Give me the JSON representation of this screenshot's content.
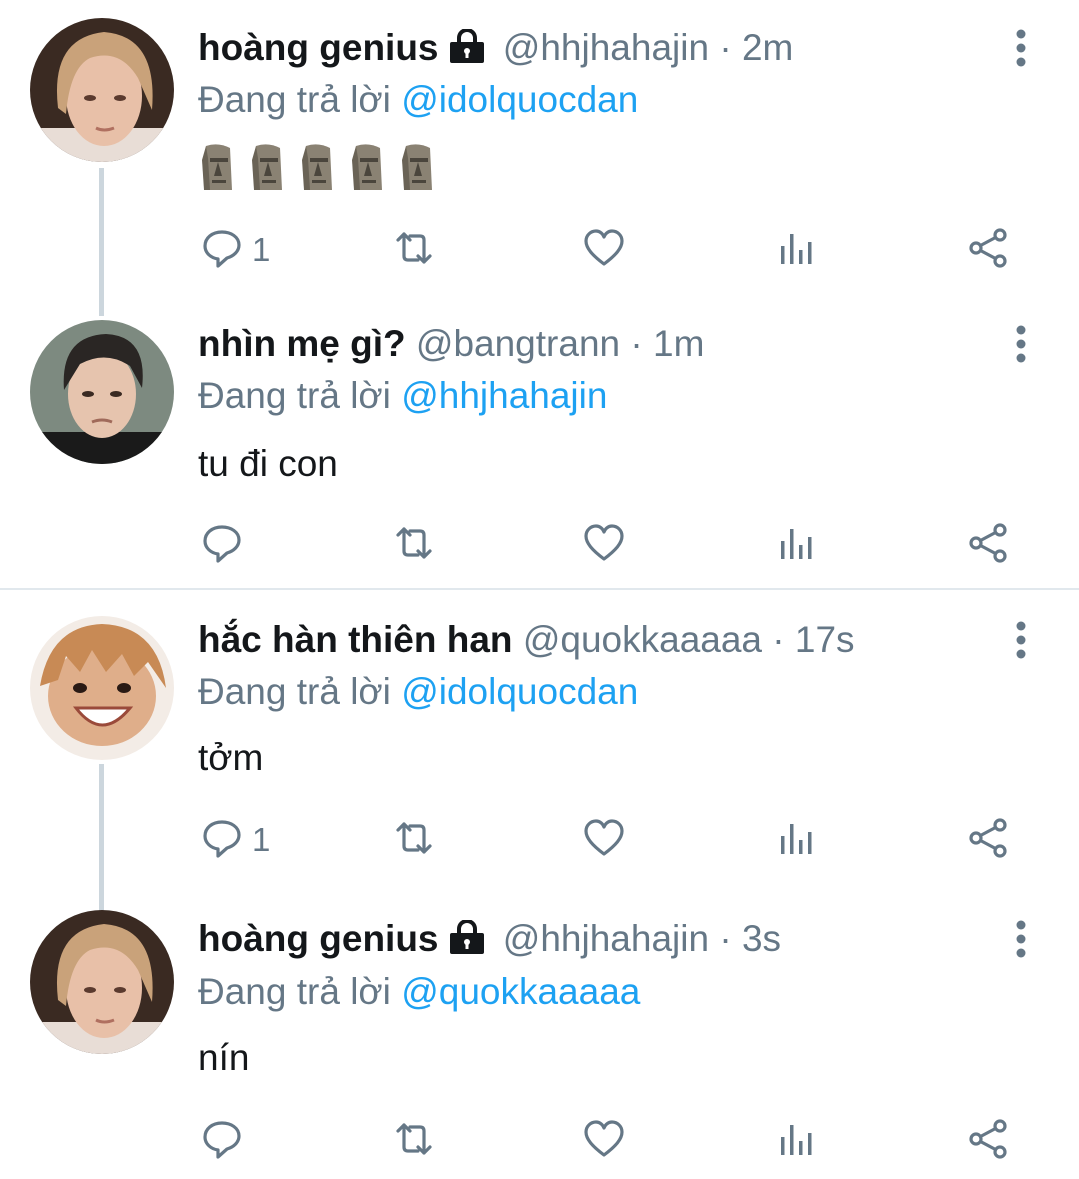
{
  "tweets": [
    {
      "display_name": "hoàng genius",
      "locked": true,
      "handle": "@hhjhahajin",
      "time": "2m",
      "reply_prefix": "Đang trả lời",
      "reply_to": "@idolquocdan",
      "text": "",
      "emoji": "🗿🗿🗿🗿🗿",
      "reply_count": "1"
    },
    {
      "display_name": "nhìn mẹ gì?",
      "locked": false,
      "handle": "@bangtrann",
      "time": "1m",
      "reply_prefix": "Đang trả lời",
      "reply_to": "@hhjhahajin",
      "text": "tu đi con",
      "reply_count": ""
    },
    {
      "display_name": "hắc hàn thiên han",
      "locked": false,
      "handle": "@quokkaaaaa",
      "time": "17s",
      "reply_prefix": "Đang trả lời",
      "reply_to": "@idolquocdan",
      "text": "tởm",
      "reply_count": "1"
    },
    {
      "display_name": "hoàng genius",
      "locked": true,
      "handle": "@hhjhahajin",
      "time": "3s",
      "reply_prefix": "Đang trả lời",
      "reply_to": "@quokkaaaaa",
      "text": "nín",
      "reply_count": ""
    }
  ],
  "separator": "·",
  "icons": [
    "lock-icon",
    "more-vertical-icon",
    "reply-icon",
    "retweet-icon",
    "like-icon",
    "analytics-icon",
    "share-icon",
    "moai-emoji"
  ],
  "colors": {
    "text": "#14171a",
    "secondary": "#657786",
    "link": "#1da1f2",
    "thread_line": "#ccd6dd",
    "divider": "#e1e8ed"
  }
}
